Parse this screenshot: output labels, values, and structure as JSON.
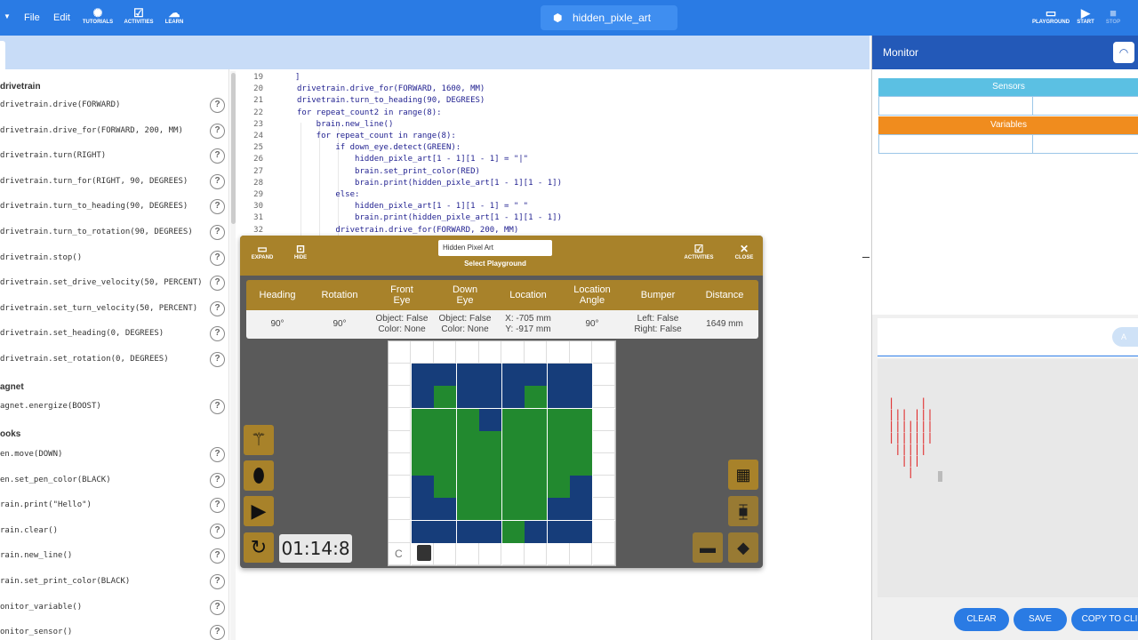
{
  "topbar": {
    "file": "File",
    "edit": "Edit",
    "tutorials": "TUTORIALS",
    "activities": "ACTIVITIES",
    "learn": "LEARN",
    "project_title": "hidden_pixle_art",
    "playground": "PLAYGROUND",
    "start": "START",
    "stop": "STOP"
  },
  "sidebar": {
    "categories": [
      "drivetrain",
      "agnet",
      "ooks"
    ],
    "drivetrain_cmds": [
      "drivetrain.drive(FORWARD)",
      "drivetrain.drive_for(FORWARD, 200, MM)",
      "drivetrain.turn(RIGHT)",
      "drivetrain.turn_for(RIGHT, 90, DEGREES)",
      "drivetrain.turn_to_heading(90, DEGREES)",
      "drivetrain.turn_to_rotation(90, DEGREES)",
      "drivetrain.stop()",
      "drivetrain.set_drive_velocity(50, PERCENT)",
      "drivetrain.set_turn_velocity(50, PERCENT)",
      "drivetrain.set_heading(0, DEGREES)",
      "drivetrain.set_rotation(0, DEGREES)"
    ],
    "magnet_cmds": [
      "agnet.energize(BOOST)"
    ],
    "looks_cmds": [
      "en.move(DOWN)",
      "en.set_pen_color(BLACK)",
      "rain.print(\"Hello\")",
      "rain.clear()",
      "rain.new_line()",
      "rain.set_print_color(BLACK)",
      "onitor_variable()",
      "onitor_sensor()"
    ],
    "help_glyph": "?"
  },
  "editor": {
    "line_numbers": [
      "19",
      "20",
      "21",
      "22",
      "23",
      "24",
      "25",
      "26",
      "27",
      "28",
      "29",
      "30",
      "31",
      "32"
    ],
    "lines": [
      "]",
      "drivetrain.drive_for(FORWARD, 1600, MM)",
      "drivetrain.turn_to_heading(90, DEGREES)",
      "for repeat_count2 in range(8):",
      "    brain.new_line()",
      "    for repeat_count in range(8):",
      "        if down_eye.detect(GREEN):",
      "            hidden_pixle_art[1 - 1][1 - 1] = \"|\"",
      "            brain.set_print_color(RED)",
      "            brain.print(hidden_pixle_art[1 - 1][1 - 1])",
      "        else:",
      "            hidden_pixle_art[1 - 1][1 - 1] = \" \"",
      "            brain.print(hidden_pixle_art[1 - 1][1 - 1])",
      "        drivetrain.drive_for(FORWARD, 200, MM)"
    ]
  },
  "monitor": {
    "title": "Monitor",
    "sensors": "Sensors",
    "variables": "Variables",
    "add_partial": "A",
    "print_lines": [
      "|    |",
      "||| |||",
      "|||||||",
      "|||||||",
      " |||||",
      "  |||",
      "   |"
    ],
    "clear": "CLEAR",
    "save": "SAVE",
    "copy": "COPY TO CLI",
    "colors": {
      "sensors": "#5bc0e3",
      "variables": "#f08c1e",
      "header": "#2359b8",
      "print": "#e02020"
    }
  },
  "playground": {
    "expand": "EXPAND",
    "hide": "HIDE",
    "activities": "ACTIVITIES",
    "close": "CLOSE",
    "name_value": "Hidden Pixel Art",
    "select": "Select Playground",
    "headers": [
      "Heading",
      "Rotation",
      "Front\nEye",
      "Down\nEye",
      "Location",
      "Location\nAngle",
      "Bumper",
      "Distance"
    ],
    "values": [
      "90°",
      "90°",
      "Object: False\nColor: None",
      "Object: False\nColor: None",
      "X: -705 mm\nY: -917 mm",
      "90°",
      "Left: False\nRight: False",
      "1649 mm"
    ],
    "timer": "01:14:8",
    "grid_letter": "C",
    "colors": {
      "chrome": "#a8822a",
      "blue": "#163d7a",
      "green": "#22892f"
    }
  }
}
